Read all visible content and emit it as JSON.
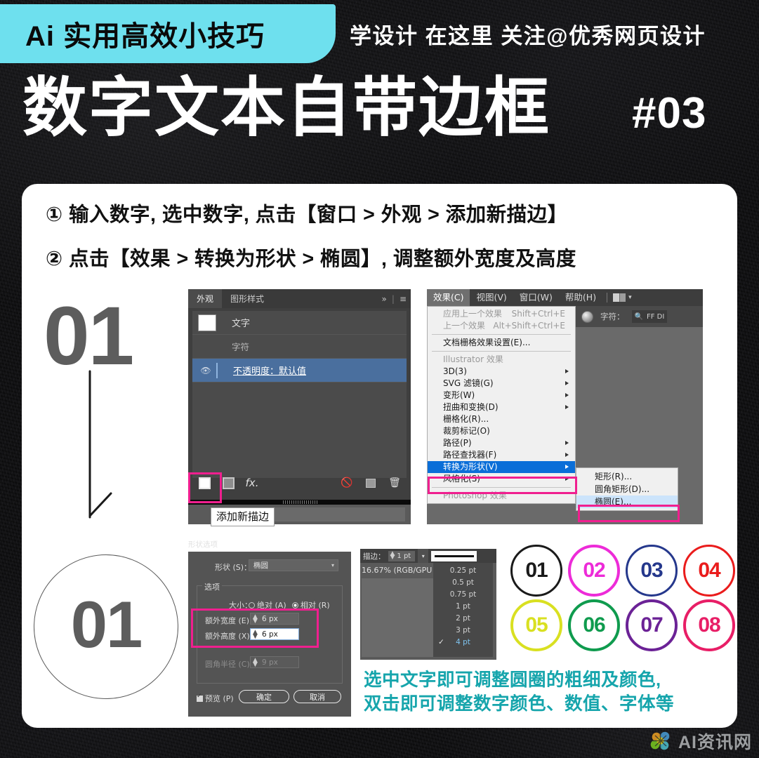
{
  "header": {
    "tag_label": "Ai 实用高效小技巧",
    "subtitle": "学设计 在这里  关注@优秀网页设计",
    "title": "数字文本自带边框",
    "number": "#03",
    "cyan": "#6EE0EE"
  },
  "steps": {
    "step1": "① 输入数字, 选中数字, 点击【窗口 > 外观 > 添加新描边】",
    "step2": "② 点击【效果 > 转换为形状 > 椭圆】, 调整额外宽度及高度"
  },
  "markers": {
    "big_number": "01",
    "circled_number": "01"
  },
  "appearance_panel": {
    "tabs": [
      {
        "label": "外观",
        "active": true
      },
      {
        "label": "图形样式",
        "active": false
      }
    ],
    "menu_icons": {
      "expand": "»",
      "hamburger": "≡"
    },
    "rows": [
      {
        "label": "文字",
        "type": "swatch"
      },
      {
        "label": "字符",
        "type": "plain"
      },
      {
        "label": "不透明度：默认值",
        "type": "selected"
      }
    ],
    "footer_buttons": [
      "add-new-stroke",
      "add-new-fill",
      "fx",
      "clear",
      "duplicate",
      "delete"
    ],
    "fx_label": "fx.",
    "tooltip": "添加新描边"
  },
  "effects_menu": {
    "menubar": [
      "效果(C)",
      "视图(V)",
      "窗口(W)",
      "帮助(H)"
    ],
    "items": [
      {
        "label": "应用上一个效果",
        "shortcut": "Shift+Ctrl+E",
        "disabled": true,
        "sub": false
      },
      {
        "label": "上一个效果",
        "shortcut": "Alt+Shift+Ctrl+E",
        "disabled": true,
        "sub": false
      },
      {
        "sep": true
      },
      {
        "label": "文档栅格效果设置(E)...",
        "shortcut": "",
        "disabled": false,
        "sub": false
      },
      {
        "sep": true
      },
      {
        "label": "Illustrator 效果",
        "shortcut": "",
        "disabled": true,
        "sub": false
      },
      {
        "label": "3D(3)",
        "shortcut": "",
        "disabled": false,
        "sub": true
      },
      {
        "label": "SVG 滤镜(G)",
        "shortcut": "",
        "disabled": false,
        "sub": true
      },
      {
        "label": "变形(W)",
        "shortcut": "",
        "disabled": false,
        "sub": true
      },
      {
        "label": "扭曲和变换(D)",
        "shortcut": "",
        "disabled": false,
        "sub": true
      },
      {
        "label": "栅格化(R)...",
        "shortcut": "",
        "disabled": false,
        "sub": false
      },
      {
        "label": "裁剪标记(O)",
        "shortcut": "",
        "disabled": false,
        "sub": false
      },
      {
        "label": "路径(P)",
        "shortcut": "",
        "disabled": false,
        "sub": true
      },
      {
        "label": "路径查找器(F)",
        "shortcut": "",
        "disabled": false,
        "sub": true
      },
      {
        "label": "转换为形状(V)",
        "shortcut": "",
        "disabled": false,
        "sub": true,
        "highlight": true
      },
      {
        "label": "风格化(S)",
        "shortcut": "",
        "disabled": false,
        "sub": true
      },
      {
        "sep": true
      },
      {
        "label": "Photoshop 效果",
        "shortcut": "",
        "disabled": true,
        "sub": false
      }
    ],
    "submenu": [
      {
        "label": "矩形(R)...",
        "selected": false
      },
      {
        "label": "圆角矩形(D)...",
        "selected": false
      },
      {
        "label": "椭圆(E)...",
        "selected": true
      }
    ],
    "toolbar": {
      "character_label": "字符：",
      "font_text": "FF DI"
    },
    "highlight_color": "#f01f8f"
  },
  "shape_options": {
    "panel_title": "形状选项",
    "shape_label": "形状 (S)：",
    "shape_value": "椭圆",
    "options_legend": "选项",
    "size_label": "大小：",
    "size_absolute": "绝对 (A)",
    "size_relative": "相对 (R)",
    "extra_width_label": "额外宽度 (E)：",
    "extra_width_value": "6 px",
    "extra_height_label": "额外高度 (X)：",
    "extra_height_value": "6 px",
    "corner_radius_label": "圆角半径 (C)：",
    "corner_radius_value": "9 px",
    "preview_label": "预览 (P)",
    "ok_label": "确定",
    "cancel_label": "取消"
  },
  "stroke_panel": {
    "stroke_label": "描边：",
    "stroke_value": "1 pt",
    "zoom_label": "16.67% (RGB/GPU",
    "options": [
      {
        "label": "0.25 pt",
        "checked": false
      },
      {
        "label": "0.5 pt",
        "checked": false
      },
      {
        "label": "0.75 pt",
        "checked": false
      },
      {
        "label": "1 pt",
        "checked": false
      },
      {
        "label": "2 pt",
        "checked": false
      },
      {
        "label": "3 pt",
        "checked": false
      },
      {
        "label": "4 pt",
        "checked": true
      }
    ]
  },
  "numbered_circles": [
    {
      "label": "01",
      "color": "#1a1a1a",
      "width": 3
    },
    {
      "label": "02",
      "color": "#ED2BD8",
      "width": 4
    },
    {
      "label": "03",
      "color": "#25388C",
      "width": 3
    },
    {
      "label": "04",
      "color": "#EA1C1C",
      "width": 3
    },
    {
      "label": "05",
      "color": "#D9E021",
      "width": 4
    },
    {
      "label": "06",
      "color": "#0F9B4E",
      "width": 4
    },
    {
      "label": "07",
      "color": "#6B2296",
      "width": 4
    },
    {
      "label": "08",
      "color": "#E81E66",
      "width": 4
    }
  ],
  "note": {
    "line1": "选中文字即可调整圆圈的粗细及颜色,",
    "line2": "双击即可调整数字颜色、数值、字体等",
    "color": "#16a5ac"
  },
  "watermark": {
    "text": "AI资讯网"
  }
}
